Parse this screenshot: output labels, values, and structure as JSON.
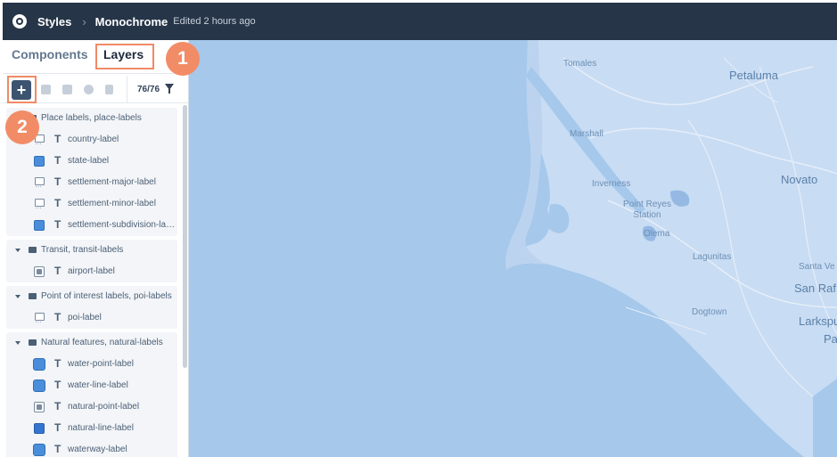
{
  "header": {
    "app_label": "Styles",
    "style_name": "Monochrome",
    "edited": "Edited 2 hours ago"
  },
  "tabs": {
    "components": "Components",
    "layers": "Layers"
  },
  "toolbar": {
    "add_label": "+",
    "layer_count": "76/76"
  },
  "callouts": {
    "one": "1",
    "two": "2"
  },
  "groups": [
    {
      "title": "Place labels, place-labels",
      "layers": [
        {
          "name": "country-label",
          "swatch": "msg"
        },
        {
          "name": "state-label",
          "swatch": "blue"
        },
        {
          "name": "settlement-major-label",
          "swatch": "msg"
        },
        {
          "name": "settlement-minor-label",
          "swatch": "msg"
        },
        {
          "name": "settlement-subdivision-label",
          "swatch": "blue"
        }
      ]
    },
    {
      "title": "Transit, transit-labels",
      "layers": [
        {
          "name": "airport-label",
          "swatch": "img"
        }
      ]
    },
    {
      "title": "Point of interest labels, poi-labels",
      "layers": [
        {
          "name": "poi-label",
          "swatch": "msg"
        }
      ]
    },
    {
      "title": "Natural features, natural-labels",
      "layers": [
        {
          "name": "water-point-label",
          "swatch": "blue-big"
        },
        {
          "name": "water-line-label",
          "swatch": "blue-big"
        },
        {
          "name": "natural-point-label",
          "swatch": "img"
        },
        {
          "name": "natural-line-label",
          "swatch": "blue-dark"
        },
        {
          "name": "waterway-label",
          "swatch": "blue-big"
        }
      ]
    }
  ],
  "map": {
    "places": [
      "Tomales",
      "Petaluma",
      "Marshall",
      "Novato",
      "Inverness",
      "Point Reyes Station",
      "Olema",
      "Lagunitas",
      "Santa Ve",
      "San Raf",
      "Dogtown",
      "Larkspu",
      "Pa"
    ],
    "colors": {
      "water": "#a5c8eb",
      "land": "#c8dcf3",
      "road": "#e6eef9"
    }
  }
}
